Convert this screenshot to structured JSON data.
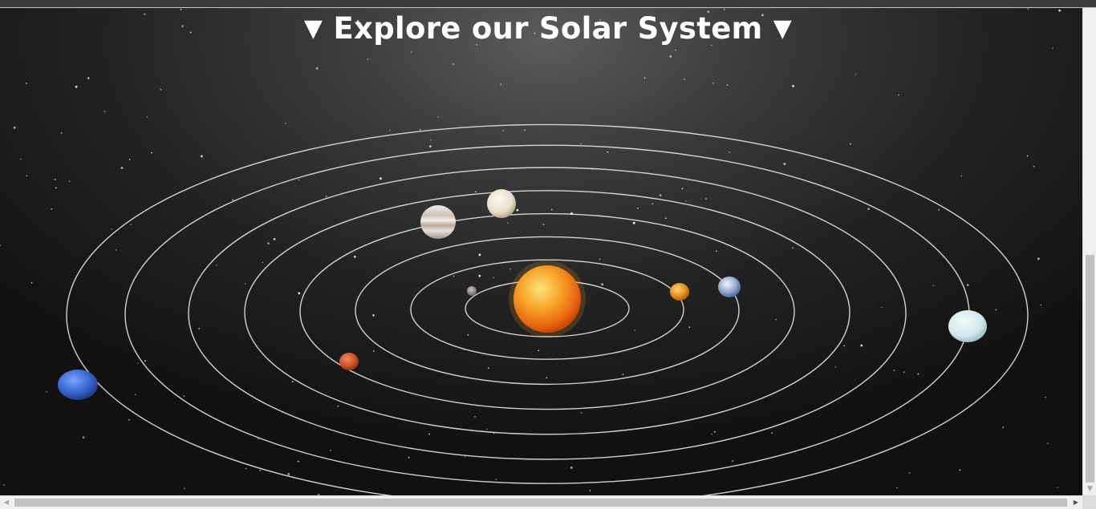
{
  "page": {
    "title": "Explore our Solar System",
    "title_prefix_icon": "▼",
    "title_suffix_icon": "▼"
  },
  "colors": {
    "orbit": "#e6e6e6",
    "title": "#ffffff",
    "space_center": "#5b5b5b",
    "space_edge": "#111111"
  },
  "planets": [
    {
      "name": "sun",
      "icon": "sun-icon",
      "color": "#f28a1c"
    },
    {
      "name": "mercury",
      "icon": "mercury-icon",
      "color": "#8f8a86"
    },
    {
      "name": "venus",
      "icon": "venus-icon",
      "color": "#e6931f"
    },
    {
      "name": "earth",
      "icon": "earth-icon",
      "color": "#9fb3d6"
    },
    {
      "name": "mars",
      "icon": "mars-icon",
      "color": "#d2542c"
    },
    {
      "name": "jupiter",
      "icon": "jupiter-icon",
      "color": "#d9d4cd"
    },
    {
      "name": "saturn",
      "icon": "saturn-icon",
      "color": "#eee8d8"
    },
    {
      "name": "uranus",
      "icon": "uranus-icon",
      "color": "#d8eef0"
    },
    {
      "name": "neptune",
      "icon": "neptune-icon",
      "color": "#3f6fd6"
    }
  ]
}
